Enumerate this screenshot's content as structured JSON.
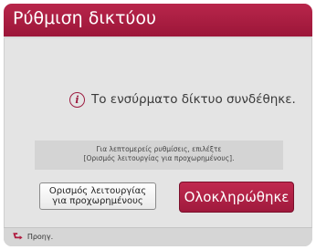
{
  "dialog": {
    "title": "Ρύθμιση δικτύου",
    "message": "Το ενσύρματο δίκτυο συνδέθηκε.",
    "message_icon": "info-icon",
    "hint_line1": "Για λεπτομερείς ρυθμίσεις, επιλέξτε",
    "hint_line2": "[Ορισμός λειτουργίας για προχωρημένους].",
    "advanced_button_line1": "Ορισμός λειτουργίας",
    "advanced_button_line2": "για προχωρημένους",
    "done_button": "Ολοκληρώθηκε"
  },
  "footer": {
    "back_icon": "back-arrow-icon",
    "back_label": "Προηγ."
  },
  "colors": {
    "accent": "#a81c43",
    "panel": "#e4e4e4",
    "hint_background": "#d4d4d4"
  }
}
